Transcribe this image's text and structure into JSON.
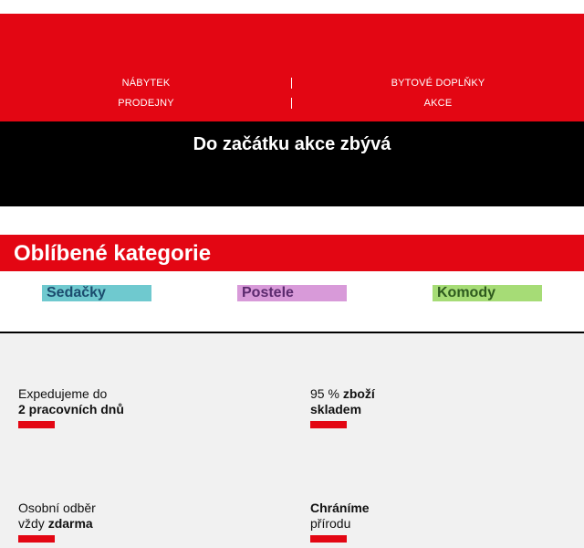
{
  "colors": {
    "brand_red": "#e30613",
    "countdown_bg": "#000000",
    "benefits_bg": "#f1f1f1"
  },
  "nav": {
    "items": [
      {
        "label": "NÁBYTEK"
      },
      {
        "label": "BYTOVÉ DOPLŇKY"
      },
      {
        "label": "PRODEJNY"
      },
      {
        "label": "AKCE"
      }
    ]
  },
  "countdown": {
    "title": "Do začátku akce zbývá"
  },
  "categories": {
    "title": "Oblíbené kategorie",
    "items": [
      {
        "label": "Sedačky",
        "bg": "#6fc9cf",
        "text_color": "#1b4c6e"
      },
      {
        "label": "Postele",
        "bg": "#d89ad9",
        "text_color": "#5b2a6e"
      },
      {
        "label": "Komody",
        "bg": "#a6dc76",
        "text_color": "#2e5a1e"
      }
    ]
  },
  "benefits": [
    {
      "line1_plain": "Expedujeme do",
      "line1_bold": "",
      "line2_plain": "",
      "line2_bold": "2 pracovních dnů"
    },
    {
      "line1_plain": "95 % ",
      "line1_bold": "zboží",
      "line2_plain": "",
      "line2_bold": "skladem"
    },
    {
      "line1_plain": "Osobní odběr",
      "line1_bold": "",
      "line2_plain": "vždy ",
      "line2_bold": "zdarma"
    },
    {
      "line1_plain": "",
      "line1_bold": "Chráníme",
      "line2_plain": "přírodu",
      "line2_bold": ""
    }
  ]
}
